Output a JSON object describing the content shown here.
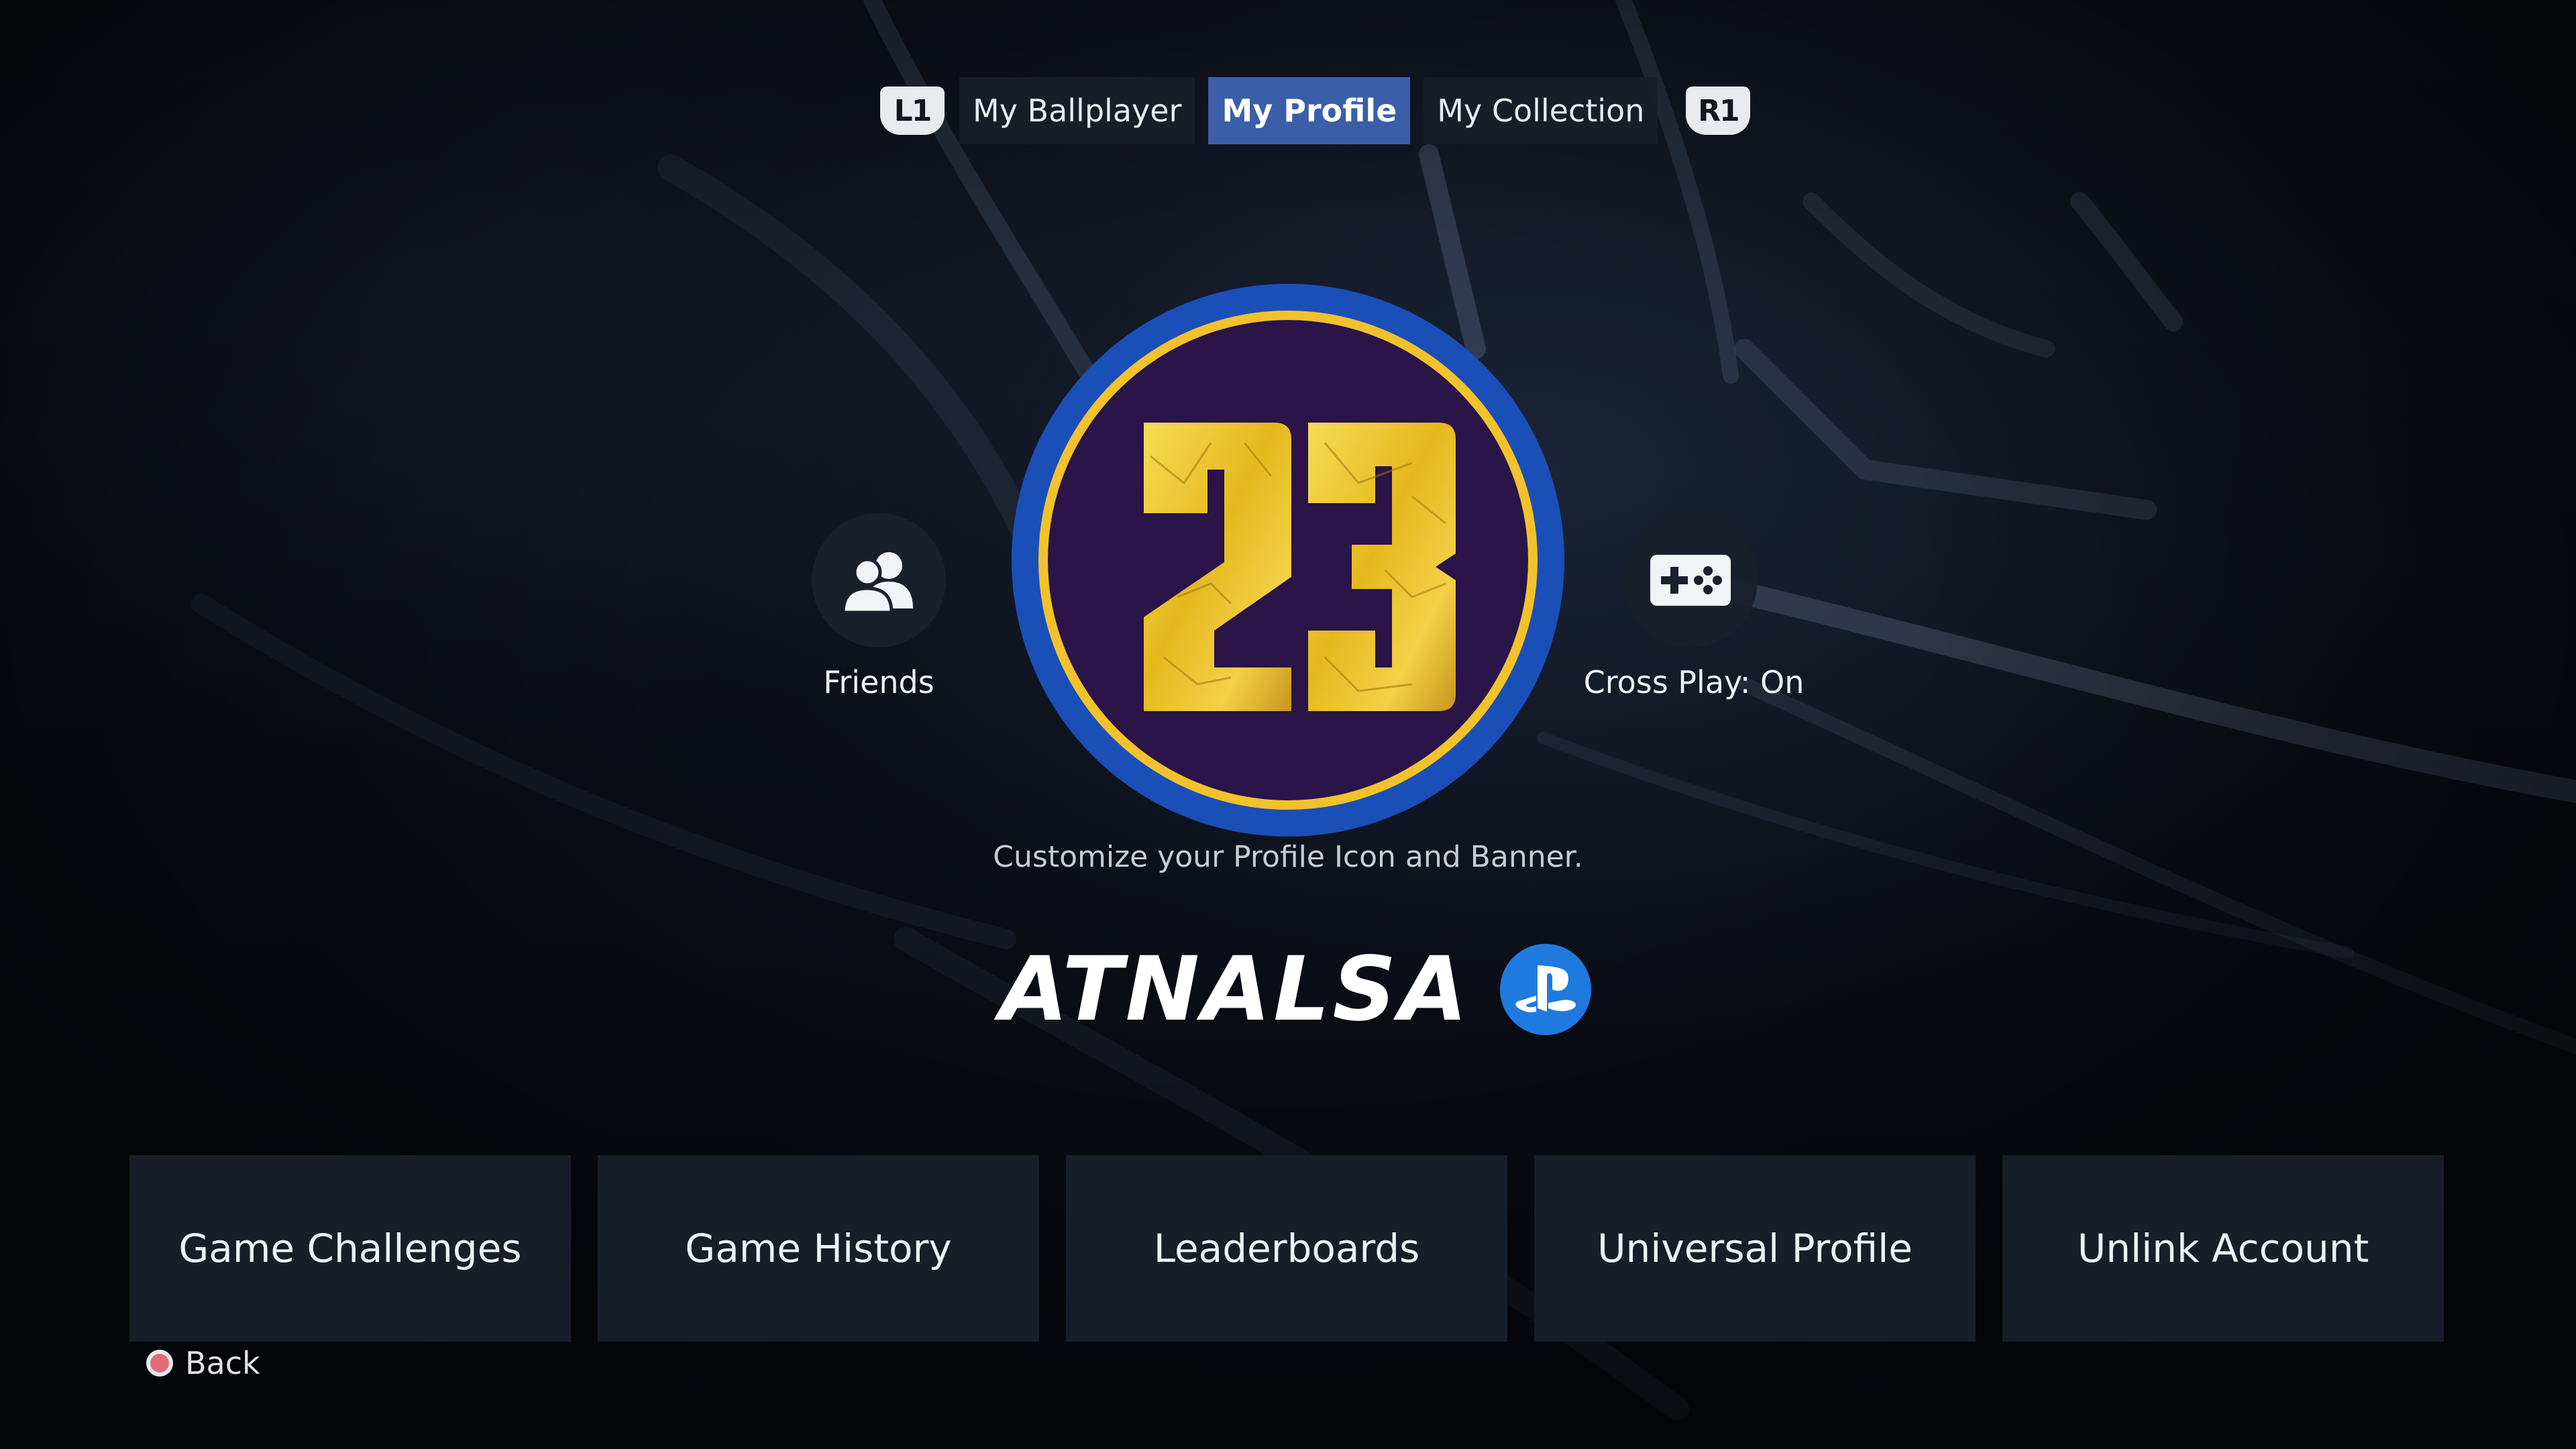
{
  "tabs": {
    "left_bumper": "L1",
    "right_bumper": "R1",
    "items": [
      {
        "label": "My Ballplayer",
        "active": false
      },
      {
        "label": "My Profile",
        "active": true
      },
      {
        "label": "My Collection",
        "active": false
      }
    ]
  },
  "profile": {
    "icon_number": "23",
    "customize_hint": "Customize your Profile Icon and Banner.",
    "username": "ATNALSA",
    "platform_icon": "playstation-logo-icon"
  },
  "side_actions": {
    "friends": {
      "label": "Friends",
      "icon": "friends-icon"
    },
    "cross_play": {
      "label": "Cross Play: On",
      "icon": "gamepad-icon"
    }
  },
  "menu": [
    {
      "label": "Game Challenges"
    },
    {
      "label": "Game History"
    },
    {
      "label": "Leaderboards"
    },
    {
      "label": "Universal Profile"
    },
    {
      "label": "Unlink Account"
    }
  ],
  "footer": {
    "back_label": "Back",
    "back_button_icon": "circle-button-icon"
  },
  "colors": {
    "active_tab": "#3a5fa8",
    "emblem_outer_ring": "#1b4fb8",
    "emblem_gold_ring": "#f2c22c",
    "emblem_inner": "#2a1448",
    "psn_blue": "#1f7ae0"
  }
}
